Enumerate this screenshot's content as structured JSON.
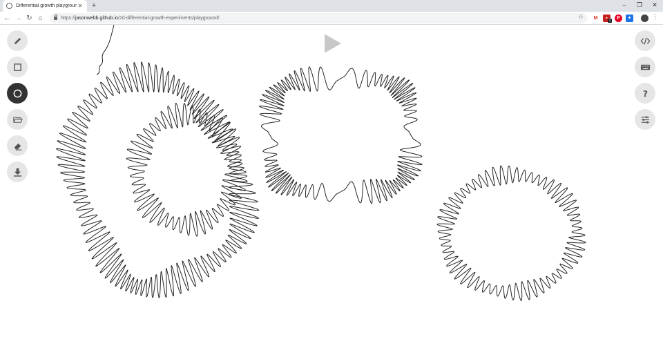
{
  "browser": {
    "tab_title": "Differential growth playground",
    "tab_close": "✕",
    "new_tab": "+",
    "url_host": "jasonwebb.github.io",
    "url_path": "/2d-differential-growth-experiments/playground/",
    "url_scheme": "https://",
    "extension_badge": "1",
    "window_controls": [
      "–",
      "❐",
      "✕"
    ]
  },
  "toolbar_left": [
    {
      "name": "draw-button",
      "icon": "pencil-icon",
      "active": false
    },
    {
      "name": "rectangle-shape-button",
      "icon": "square-icon",
      "active": false
    },
    {
      "name": "circle-shape-button",
      "icon": "circle-icon",
      "active": true
    },
    {
      "name": "open-file-button",
      "icon": "folder-open-icon",
      "active": false
    },
    {
      "name": "clear-button",
      "icon": "eraser-icon",
      "active": false
    },
    {
      "name": "download-button",
      "icon": "download-icon",
      "active": false
    }
  ],
  "toolbar_right": [
    {
      "name": "view-source-button",
      "icon": "code-icon"
    },
    {
      "name": "keyboard-shortcuts-button",
      "icon": "keyboard-icon"
    },
    {
      "name": "help-button",
      "icon": "question-mark-icon"
    },
    {
      "name": "settings-button",
      "icon": "sliders-icon"
    }
  ],
  "play_button": {
    "icon": "play-icon",
    "state": "paused"
  },
  "colors": {
    "active_tool": "#333333",
    "tool_bg": "#e6e6e6",
    "stroke": "#222222",
    "play": "#c8c8c8"
  }
}
